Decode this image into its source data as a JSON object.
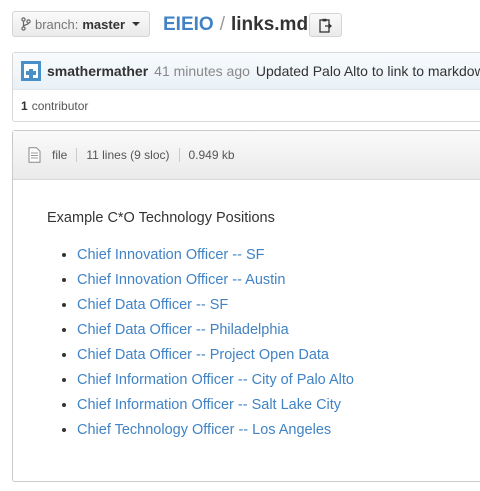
{
  "branch": {
    "prefix": "branch:",
    "name": "master"
  },
  "path": {
    "repo": "EIEIO",
    "separator": "/",
    "file": "links.md"
  },
  "commit": {
    "author": "smathermather",
    "time": "41 minutes ago",
    "message": "Updated Palo Alto to link to markdown"
  },
  "contributors": {
    "count": "1",
    "label": "contributor"
  },
  "file_info": {
    "type": "file",
    "lines": "11 lines (9 sloc)",
    "size": "0.949 kb"
  },
  "content": {
    "heading": "Example C*O Technology Positions",
    "links": [
      "Chief Innovation Officer -- SF",
      "Chief Innovation Officer -- Austin",
      "Chief Data Officer -- SF",
      "Chief Data Officer -- Philadelphia",
      "Chief Data Officer -- Project Open Data",
      "Chief Information Officer -- City of Palo Alto",
      "Chief Information Officer -- Salt Lake City",
      "Chief Technology Officer -- Los Angeles"
    ]
  },
  "colors": {
    "link": "#4183c4",
    "avatar": "#4a90c8"
  }
}
